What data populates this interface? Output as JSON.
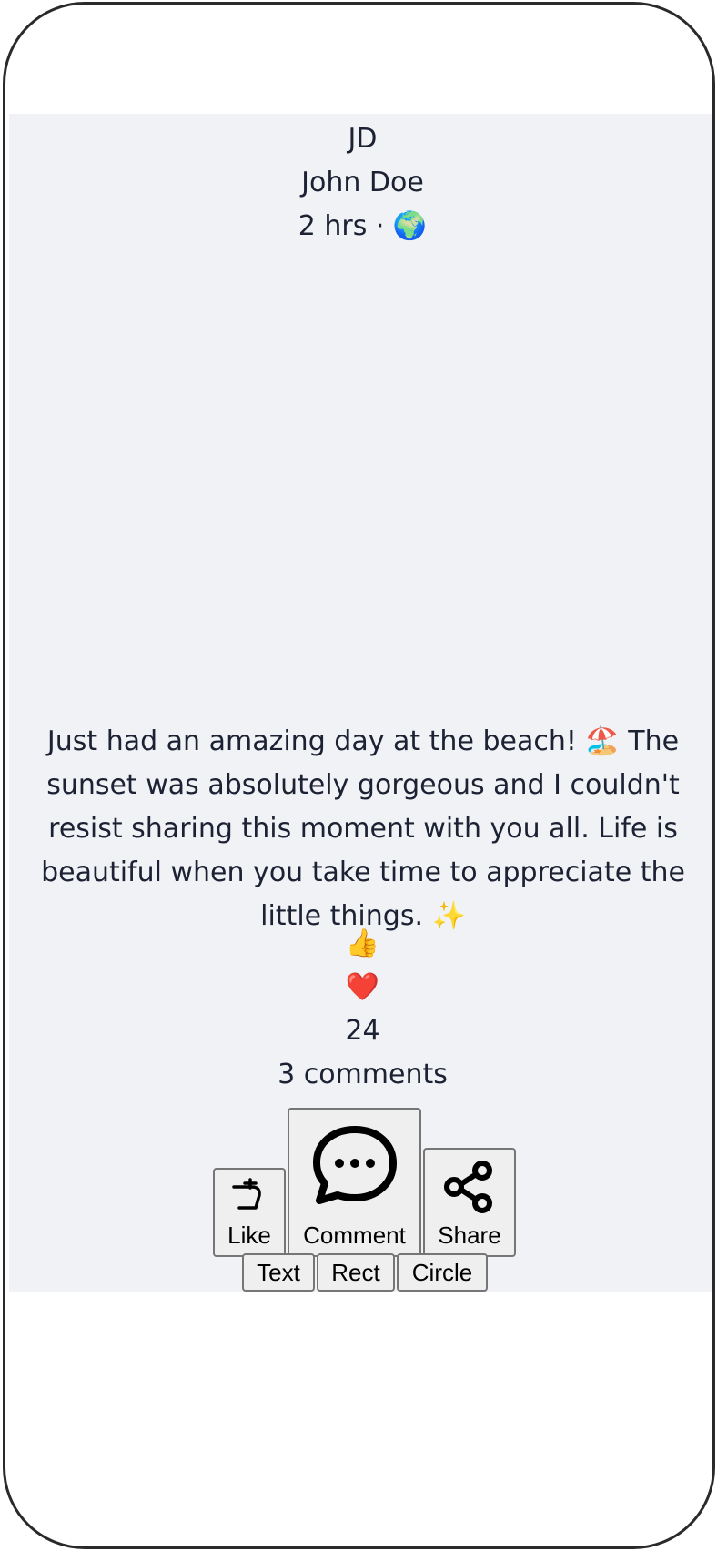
{
  "post": {
    "avatar_initials": "JD",
    "author": "John Doe",
    "meta": "2 hrs · 🌍",
    "content": "Just had an amazing day at the beach! 🏖️ The sunset was absolutely gorgeous and I couldn't resist sharing this moment with you all. Life is beautiful when you take time to appreciate the little things. ✨",
    "reaction_like": "👍",
    "reaction_heart": "❤️",
    "reaction_count": "24",
    "comments": "3 comments"
  },
  "actions": {
    "like_label": "Like",
    "comment_label": "Comment",
    "share_label": "Share"
  },
  "tools": {
    "text_label": "Text",
    "rect_label": "Rect",
    "circle_label": "Circle"
  },
  "colors": {
    "card_background": "#f0f2f5",
    "text": "#1c2233",
    "button_background": "#efefef",
    "button_border": "#767676"
  }
}
